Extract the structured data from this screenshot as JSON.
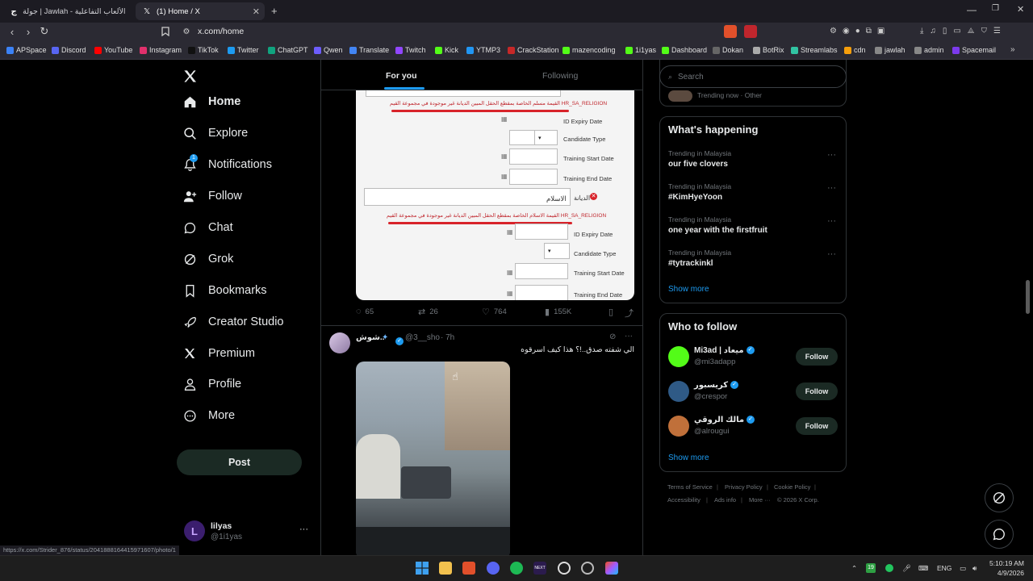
{
  "browser": {
    "tabs": [
      {
        "label": "جولة | Jawlah - منصة الألعاب التفاعلية",
        "active": false
      },
      {
        "label": "(1) Home / X",
        "active": true
      }
    ],
    "url": "x.com/home",
    "bookmarks": [
      {
        "label": "APSpace",
        "color": "#3b82f6"
      },
      {
        "label": "Discord",
        "color": "#5865f2"
      },
      {
        "label": "YouTube",
        "color": "#ff0000"
      },
      {
        "label": "Instagram",
        "color": "#e1306c"
      },
      {
        "label": "TikTok",
        "color": "#111111"
      },
      {
        "label": "Twitter",
        "color": "#1d9bf0"
      },
      {
        "label": "ChatGPT",
        "color": "#10a37f"
      },
      {
        "label": "Qwen",
        "color": "#6d5dfc"
      },
      {
        "label": "Translate",
        "color": "#4285f4"
      },
      {
        "label": "Twitch",
        "color": "#9146ff"
      },
      {
        "label": "Kick",
        "color": "#53fc18"
      },
      {
        "label": "YTMP3",
        "color": "#2196f3"
      },
      {
        "label": "CrackStation",
        "color": "#c62828"
      },
      {
        "label": "mazencoding",
        "color": "#53fc18"
      },
      {
        "label": "1i1yas",
        "color": "#53fc18"
      },
      {
        "label": "Dashboard",
        "color": "#53fc18"
      },
      {
        "label": "Dokan",
        "color": "#666666"
      },
      {
        "label": "BotRix",
        "color": "#aaaaaa"
      },
      {
        "label": "Streamlabs",
        "color": "#31c3a2"
      },
      {
        "label": "cdn",
        "color": "#f59e0b"
      },
      {
        "label": "jawlah",
        "color": "#888888"
      },
      {
        "label": "admin",
        "color": "#888888"
      },
      {
        "label": "Spacemail",
        "color": "#7c3aed"
      }
    ],
    "status_url": "https://x.com/Strider_876/status/2041888164415971607/photo/1"
  },
  "sidebar": {
    "items": [
      {
        "label": "Home",
        "icon": "home-icon"
      },
      {
        "label": "Explore",
        "icon": "search-icon"
      },
      {
        "label": "Notifications",
        "icon": "bell-icon",
        "badge": "1"
      },
      {
        "label": "Follow",
        "icon": "follow-icon"
      },
      {
        "label": "Chat",
        "icon": "chat-icon"
      },
      {
        "label": "Grok",
        "icon": "grok-icon"
      },
      {
        "label": "Bookmarks",
        "icon": "bookmark-icon"
      },
      {
        "label": "Creator Studio",
        "icon": "rocket-icon"
      },
      {
        "label": "Premium",
        "icon": "x-logo-icon"
      },
      {
        "label": "Profile",
        "icon": "person-icon"
      },
      {
        "label": "More",
        "icon": "more-icon"
      }
    ],
    "post_label": "Post",
    "account": {
      "name": "lilyas",
      "handle": "@1i1yas",
      "initial": "L"
    }
  },
  "feed": {
    "tabs": {
      "for_you": "For you",
      "following": "Following"
    },
    "tweet1": {
      "form": {
        "red1": "القيمة مسلم الخاصة بمقطع الحقل المبين الديانة غير موجودة في مجموعة القيم HR_SA_RELIGION",
        "id_expiry": "ID Expiry Date",
        "candidate_type": "Candidate Type",
        "training_start": "Training Start Date",
        "training_end": "Training End Date",
        "religion_label": "الديانة",
        "religion_value": "الاسلام",
        "red2": "القيمة الاسلام الخاصة بمقطع الحقل المبين الديانة غير موجودة في مجموعة القيم HR_SA_RELIGION"
      },
      "stats": {
        "replies": "65",
        "reposts": "26",
        "likes": "764",
        "views": "155K"
      }
    },
    "tweet2": {
      "name": "شوش..",
      "handle": "@3__sho",
      "time": "· 7h",
      "text": "الي شفته صدق..!؟ هذا كيف اسرقوه"
    }
  },
  "right": {
    "search_placeholder": "Search",
    "trending_top": "Trending now · Other",
    "whats_happening": "What's happening",
    "trends": [
      {
        "meta": "Trending in Malaysia",
        "name": "our five clovers"
      },
      {
        "meta": "Trending in Malaysia",
        "name": "#KimHyeYoon"
      },
      {
        "meta": "Trending in Malaysia",
        "name": "one year with the firstfruit"
      },
      {
        "meta": "Trending in Malaysia",
        "name": "#tytrackinkl"
      }
    ],
    "show_more": "Show more",
    "who_to_follow": "Who to follow",
    "suggestions": [
      {
        "name": "Mi3ad | ميعاد",
        "handle": "@mi3adapp",
        "follow": "Follow",
        "color": "#53fc18"
      },
      {
        "name": "كريسبور",
        "handle": "@crespor",
        "follow": "Follow",
        "color": "#2f5a86"
      },
      {
        "name": "مالك الروقي",
        "handle": "@alrougui",
        "follow": "Follow",
        "color": "#c0703a"
      }
    ],
    "show_more_2": "Show more",
    "footer": {
      "terms": "Terms of Service",
      "privacy": "Privacy Policy",
      "cookie": "Cookie Policy",
      "accessibility": "Accessibility",
      "ads": "Ads info",
      "more": "More ···",
      "copyright": "© 2026 X Corp."
    }
  },
  "taskbar": {
    "lang": "ENG",
    "time": "5:10:19 AM",
    "date": "4/9/2026",
    "badge": "19"
  }
}
